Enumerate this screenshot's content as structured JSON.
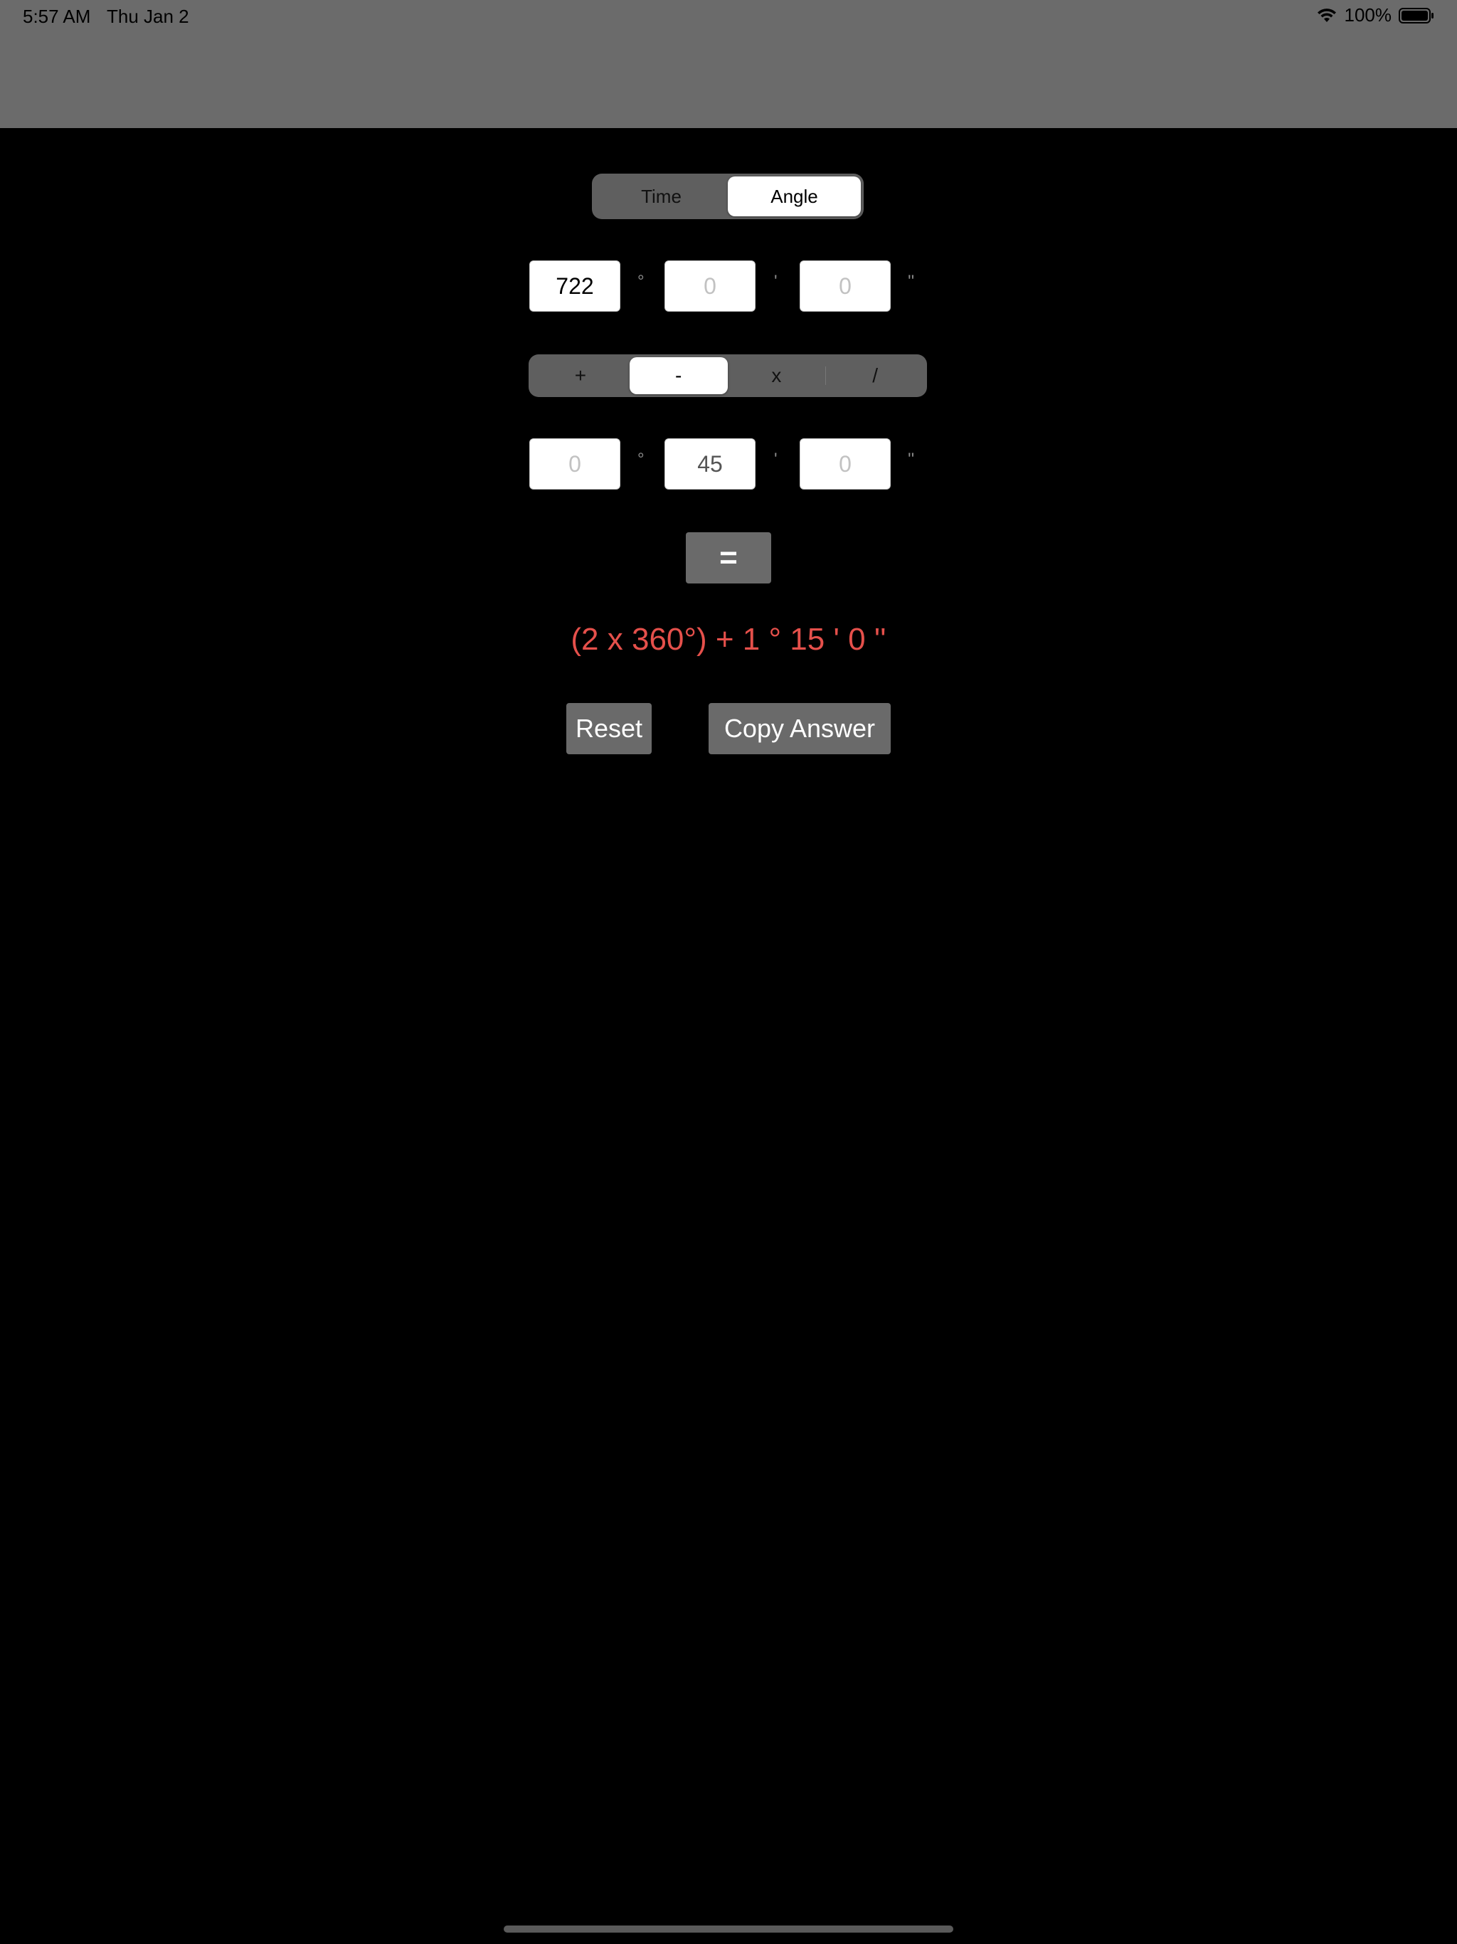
{
  "status": {
    "time": "5:57 AM",
    "date": "Thu Jan 2",
    "battery": "100%",
    "wifi_icon": "wifi-icon",
    "battery_icon": "battery-icon"
  },
  "mode": {
    "options": [
      "Time",
      "Angle"
    ],
    "selected": "Angle"
  },
  "input1": {
    "degrees": "722",
    "minutes_placeholder": "0",
    "seconds_placeholder": "0"
  },
  "units": {
    "degree": "°",
    "minute": "'",
    "second": "''"
  },
  "operation": {
    "options": [
      "+",
      "-",
      "x",
      "/"
    ],
    "selected": "-"
  },
  "input2": {
    "degrees_placeholder": "0",
    "minutes": "45",
    "seconds_placeholder": "0"
  },
  "equals_label": "=",
  "result": "(2 x 360°) + 1 ° 15 ' 0 ''",
  "buttons": {
    "reset": "Reset",
    "copy": "Copy Answer"
  },
  "colors": {
    "result": "#e5504b",
    "button_bg": "#6a6a6a",
    "segment_bg": "#5f5f5f"
  }
}
